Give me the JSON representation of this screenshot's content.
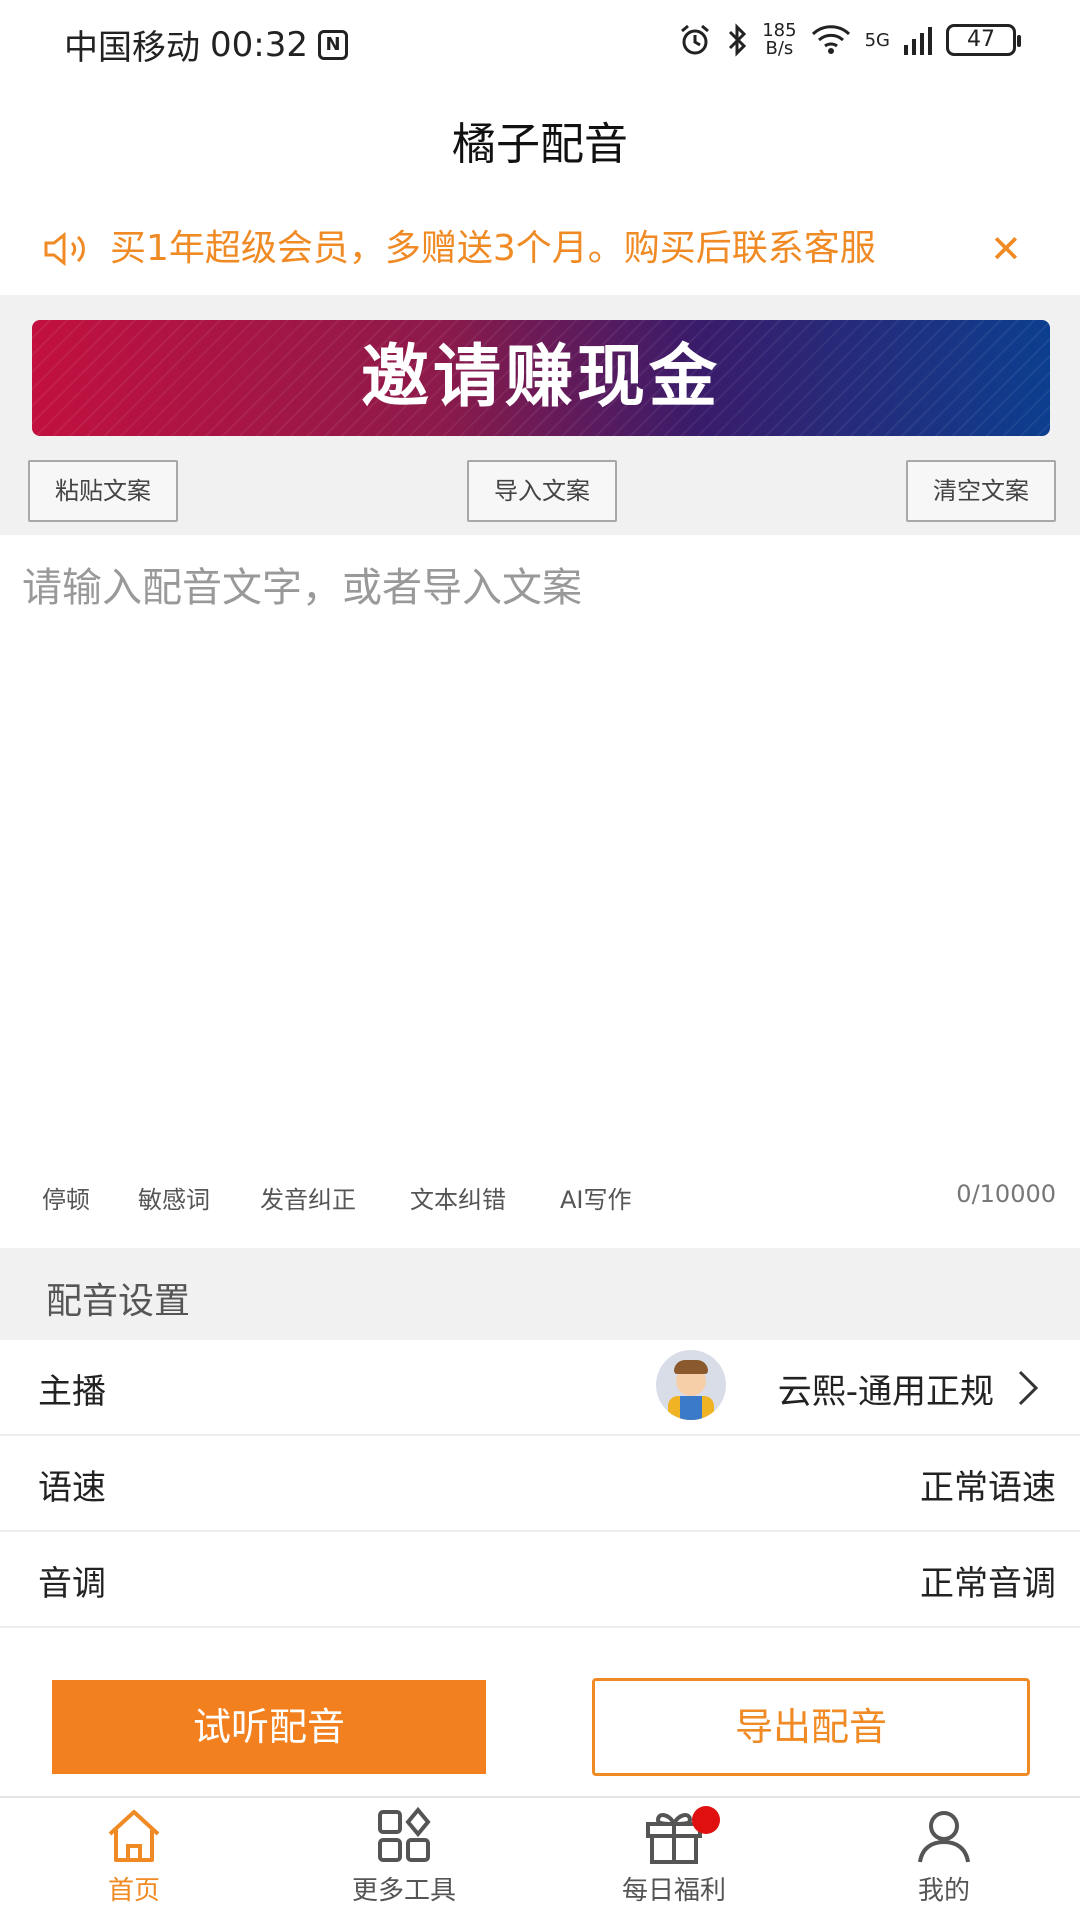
{
  "status_bar": {
    "carrier": "中国移动",
    "time": "00:32",
    "nfc": "N",
    "net_speed_value": "185",
    "net_speed_unit": "B/s",
    "signal": "5G",
    "battery": "47"
  },
  "header": {
    "title": "橘子配音"
  },
  "notice": {
    "text": "买1年超级会员，多赠送3个月。购买后联系客服",
    "close": "✕"
  },
  "banner": {
    "text": "邀请赚现金"
  },
  "tools": {
    "paste": "粘贴文案",
    "import": "导入文案",
    "clear": "清空文案"
  },
  "editor": {
    "placeholder": "请输入配音文字，或者导入文案",
    "actions": [
      "停顿",
      "敏感词",
      "发音纠正",
      "文本纠错",
      "AI写作"
    ],
    "counter": "0/10000"
  },
  "settings": {
    "title": "配音设置",
    "anchor_label": "主播",
    "anchor_value": "云熙-通用正规",
    "speed_label": "语速",
    "speed_value": "正常语速",
    "tone_label": "音调",
    "tone_value": "正常音调"
  },
  "actions": {
    "listen": "试听配音",
    "export": "导出配音"
  },
  "nav": {
    "items": [
      {
        "label": "首页",
        "icon": "home-icon",
        "active": true
      },
      {
        "label": "更多工具",
        "icon": "grid-icon",
        "active": false
      },
      {
        "label": "每日福利",
        "icon": "gift-icon",
        "active": false
      },
      {
        "label": "我的",
        "icon": "user-icon",
        "active": false
      }
    ]
  },
  "colors": {
    "accent": "#f08a24",
    "button": "#f3801f",
    "badge": "#e01010"
  }
}
